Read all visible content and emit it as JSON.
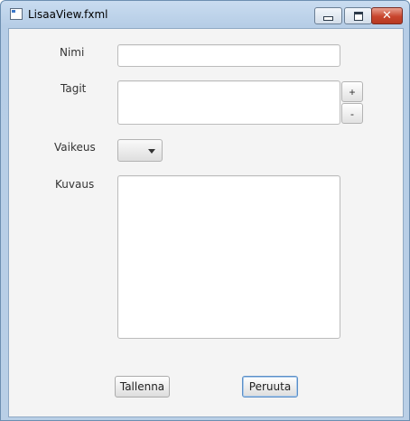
{
  "window": {
    "title": "LisaaView.fxml"
  },
  "form": {
    "nimi_label": "Nimi",
    "nimi_value": "",
    "tagit_label": "Tagit",
    "tagit_value": "",
    "add_tag_label": "+",
    "remove_tag_label": "-",
    "vaikeus_label": "Vaikeus",
    "vaikeus_selected": "",
    "kuvaus_label": "Kuvaus",
    "kuvaus_value": ""
  },
  "actions": {
    "save_label": "Tallenna",
    "cancel_label": "Peruuta"
  }
}
